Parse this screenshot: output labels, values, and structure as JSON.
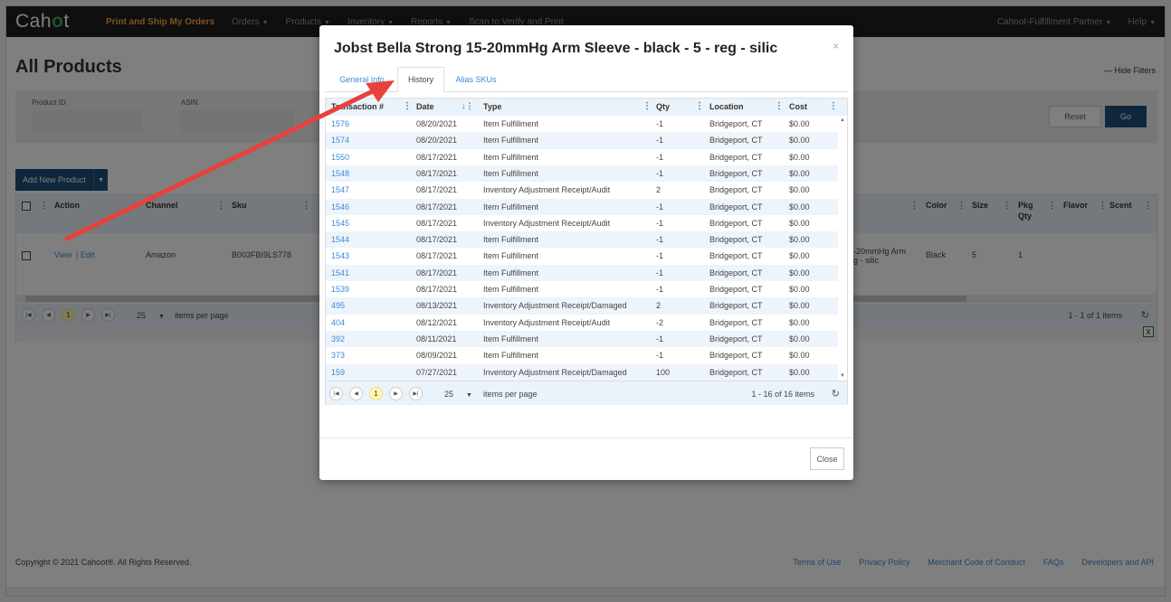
{
  "nav": {
    "logo_left": "Cah",
    "logo_o": "o",
    "logo_right": "t",
    "items": [
      "Print and Ship My Orders",
      "Orders",
      "Products",
      "Inventory",
      "Reports",
      "Scan to Verify and Print"
    ],
    "right": [
      "Cahoot-Fulfillment Partner",
      "Help"
    ]
  },
  "page": {
    "title": "All Products",
    "hide_filters": "Hide Filters",
    "filters": {
      "product_id": "Product ID",
      "asin": "ASIN"
    },
    "reset": "Reset",
    "go": "Go",
    "add_new": "Add New Product"
  },
  "grid": {
    "headers": [
      "Action",
      "Channel",
      "Sku",
      "Color",
      "Size",
      "Pkg",
      "Qty",
      "Flavor",
      "Scent"
    ],
    "row": {
      "view": "View",
      "sep": "|",
      "edit": "Edit",
      "channel": "Amazon",
      "sku": "B003FBI9LS778",
      "name1": "-20mmHg Arm",
      "name2": "g - silic",
      "color": "Black",
      "size": "5",
      "pkg": "1"
    },
    "pager": {
      "page": "1",
      "per_page": "25",
      "per_label": "items per page",
      "info": "1 - 1 of 1 items"
    }
  },
  "footer": {
    "copyright": "Copyright © 2021 Cahoot®. All Rights Reserved.",
    "links": [
      "Terms of Use",
      "Privacy Policy",
      "Merchant Code of Conduct",
      "FAQs",
      "Developers and API"
    ]
  },
  "modal": {
    "title": "Jobst Bella Strong 15-20mmHg Arm Sleeve - black - 5 - reg - silic",
    "close_x": "×",
    "tabs": [
      "General Info",
      "History",
      "Alias SKUs"
    ],
    "columns": [
      "Transaction #",
      "Date",
      "Type",
      "Qty",
      "Location",
      "Cost"
    ],
    "rows": [
      [
        "1576",
        "08/20/2021",
        "Item Fulfillment",
        "-1",
        "Bridgeport, CT",
        "$0.00"
      ],
      [
        "1574",
        "08/20/2021",
        "Item Fulfillment",
        "-1",
        "Bridgeport, CT",
        "$0.00"
      ],
      [
        "1550",
        "08/17/2021",
        "Item Fulfillment",
        "-1",
        "Bridgeport, CT",
        "$0.00"
      ],
      [
        "1548",
        "08/17/2021",
        "Item Fulfillment",
        "-1",
        "Bridgeport, CT",
        "$0.00"
      ],
      [
        "1547",
        "08/17/2021",
        "Inventory Adjustment Receipt/Audit",
        "2",
        "Bridgeport, CT",
        "$0.00"
      ],
      [
        "1546",
        "08/17/2021",
        "Item Fulfillment",
        "-1",
        "Bridgeport, CT",
        "$0.00"
      ],
      [
        "1545",
        "08/17/2021",
        "Inventory Adjustment Receipt/Audit",
        "-1",
        "Bridgeport, CT",
        "$0.00"
      ],
      [
        "1544",
        "08/17/2021",
        "Item Fulfillment",
        "-1",
        "Bridgeport, CT",
        "$0.00"
      ],
      [
        "1543",
        "08/17/2021",
        "Item Fulfillment",
        "-1",
        "Bridgeport, CT",
        "$0.00"
      ],
      [
        "1541",
        "08/17/2021",
        "Item Fulfillment",
        "-1",
        "Bridgeport, CT",
        "$0.00"
      ],
      [
        "1539",
        "08/17/2021",
        "Item Fulfillment",
        "-1",
        "Bridgeport, CT",
        "$0.00"
      ],
      [
        "495",
        "08/13/2021",
        "Inventory Adjustment Receipt/Damaged",
        "2",
        "Bridgeport, CT",
        "$0.00"
      ],
      [
        "404",
        "08/12/2021",
        "Inventory Adjustment Receipt/Audit",
        "-2",
        "Bridgeport, CT",
        "$0.00"
      ],
      [
        "392",
        "08/11/2021",
        "Item Fulfillment",
        "-1",
        "Bridgeport, CT",
        "$0.00"
      ],
      [
        "373",
        "08/09/2021",
        "Item Fulfillment",
        "-1",
        "Bridgeport, CT",
        "$0.00"
      ],
      [
        "159",
        "07/27/2021",
        "Inventory Adjustment Receipt/Damaged",
        "100",
        "Bridgeport, CT",
        "$0.00"
      ]
    ],
    "pager": {
      "page": "1",
      "per_page": "25",
      "per_label": "items per page",
      "info": "1 - 16 of 16 items"
    },
    "close": "Close"
  },
  "colors": {
    "nav_bg": "#1e1e1e",
    "accent": "#f2a83b",
    "primary": "#1f4e79",
    "link": "#3a8ad9",
    "arrow": "#e8413c"
  }
}
